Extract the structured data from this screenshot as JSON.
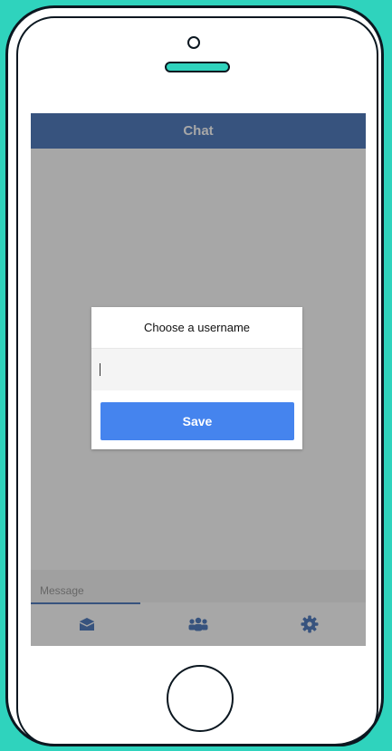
{
  "header": {
    "title": "Chat"
  },
  "composer": {
    "placeholder": "Message"
  },
  "tabs": [
    {
      "icon": "inbox-icon",
      "active": true
    },
    {
      "icon": "users-icon",
      "active": false
    },
    {
      "icon": "gear-icon",
      "active": false
    }
  ],
  "dialog": {
    "title": "Choose a username",
    "input_value": "",
    "save_label": "Save"
  },
  "colors": {
    "background": "#2fd3bd",
    "header": "#3467b5",
    "primary_button": "#4584ee"
  }
}
